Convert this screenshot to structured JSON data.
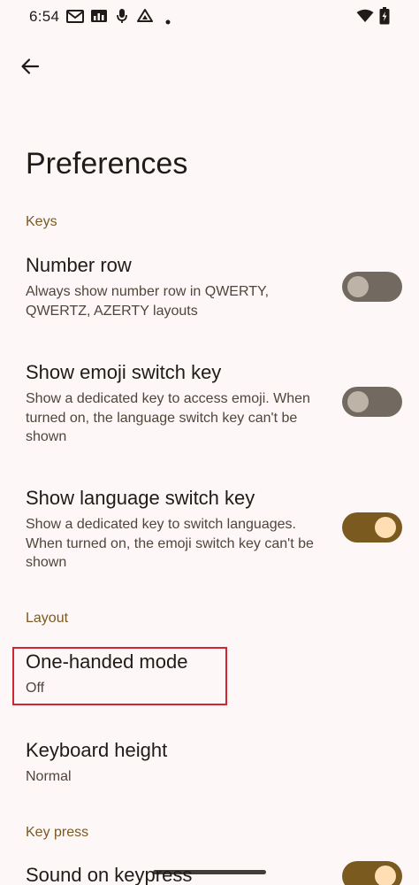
{
  "status_bar": {
    "time": "6:54"
  },
  "header": {
    "title": "Preferences"
  },
  "sections": {
    "keys": {
      "label": "Keys",
      "items": [
        {
          "title": "Number row",
          "summary": "Always show number row in QWERTY, QWERTZ, AZERTY layouts",
          "toggle_on": false
        },
        {
          "title": "Show emoji switch key",
          "summary": "Show a dedicated key to access emoji. When turned on, the language switch key can't be shown",
          "toggle_on": false
        },
        {
          "title": "Show language switch key",
          "summary": "Show a dedicated key to switch languages. When turned on, the emoji switch key can't be shown",
          "toggle_on": true
        }
      ]
    },
    "layout": {
      "label": "Layout",
      "items": [
        {
          "title": "One-handed mode",
          "summary": "Off"
        },
        {
          "title": "Keyboard height",
          "summary": "Normal"
        }
      ]
    },
    "key_press": {
      "label": "Key press",
      "items": [
        {
          "title": "Sound on keypress",
          "toggle_on": true
        }
      ]
    }
  },
  "colors": {
    "accent": "#7B5A20",
    "background": "#FDF7F8",
    "highlight": "#D0262F"
  }
}
